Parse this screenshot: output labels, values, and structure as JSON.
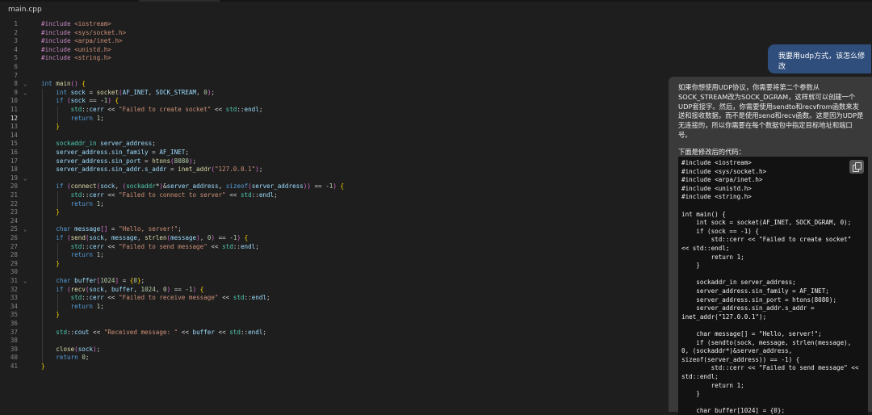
{
  "tab": {
    "title": "main.cpp"
  },
  "editor": {
    "active_line": 12,
    "line_numbers": [
      "1",
      "2",
      "3",
      "4",
      "5",
      "6",
      "7",
      "8",
      "9",
      "10",
      "11",
      "12",
      "13",
      "14",
      "15",
      "16",
      "17",
      "18",
      "19",
      "20",
      "21",
      "22",
      "23",
      "24",
      "25",
      "26",
      "27",
      "28",
      "29",
      "30",
      "31",
      "32",
      "33",
      "34",
      "35",
      "36",
      "37",
      "38",
      "39",
      "40",
      "41"
    ],
    "fold_lines": [
      8,
      9,
      19,
      25,
      31
    ],
    "lines": [
      "#include <iostream>",
      "#include <sys/socket.h>",
      "#include <arpa/inet.h>",
      "#include <unistd.h>",
      "#include <string.h>",
      "",
      "",
      "int main() {",
      "    int sock = socket(AF_INET, SOCK_STREAM, 0);",
      "    if (sock == -1) {",
      "        std::cerr << \"Failed to create socket\" << std::endl;",
      "        return 1;",
      "    }",
      "",
      "    sockaddr_in server_address;",
      "    server_address.sin_family = AF_INET;",
      "    server_address.sin_port = htons(8080);",
      "    server_address.sin_addr.s_addr = inet_addr(\"127.0.0.1\");",
      "",
      "    if (connect(sock, (sockaddr*)&server_address, sizeof(server_address)) == -1) {",
      "        std::cerr << \"Failed to connect to server\" << std::endl;",
      "        return 1;",
      "    }",
      "",
      "    char message[] = \"Hello, server!\";",
      "    if (send(sock, message, strlen(message), 0) == -1) {",
      "        std::cerr << \"Failed to send message\" << std::endl;",
      "        return 1;",
      "    }",
      "",
      "    char buffer[1024] = {0};",
      "    if (recv(sock, buffer, 1024, 0) == -1) {",
      "        std::cerr << \"Failed to receive message\" << std::endl;",
      "        return 1;",
      "    }",
      "",
      "    std::cout << \"Received message: \" << buffer << std::endl;",
      "",
      "    close(sock);",
      "    return 0;",
      "}"
    ]
  },
  "chat": {
    "user_message": "我要用udp方式，该怎么修改",
    "reply_paragraph": "如果你想使用UDP协议，你需要将第二个参数从SOCK_STREAM改为SOCK_DGRAM，这样就可以创建一个UDP套接字。然后，你需要使用sendto和recvfrom函数来发送和接收数据，而不是使用send和recv函数。这是因为UDP是无连接的，所以你需要在每个数据包中指定目标地址和端口号。",
    "reply_lead": "下面是修改后的代码：",
    "code_lines": [
      "#include <iostream>",
      "#include <sys/socket.h>",
      "#include <arpa/inet.h>",
      "#include <unistd.h>",
      "#include <string.h>",
      "",
      "int main() {",
      "    int sock = socket(AF_INET, SOCK_DGRAM, 0);",
      "    if (sock == -1) {",
      "        std::cerr << \"Failed to create socket\"",
      "<< std::endl;",
      "        return 1;",
      "    }",
      "",
      "    sockaddr_in server_address;",
      "    server_address.sin_family = AF_INET;",
      "    server_address.sin_port = htons(8080);",
      "    server_address.sin_addr.s_addr =",
      "inet_addr(\"127.0.0.1\");",
      "",
      "    char message[] = \"Hello, server!\";",
      "    if (sendto(sock, message, strlen(message),",
      "0, (sockaddr*)&server_address,",
      "sizeof(server_address)) == -1) {",
      "        std::cerr << \"Failed to send message\" <<",
      "std::endl;",
      "        return 1;",
      "    }",
      "",
      "    char buffer[1024] = {0};"
    ]
  }
}
